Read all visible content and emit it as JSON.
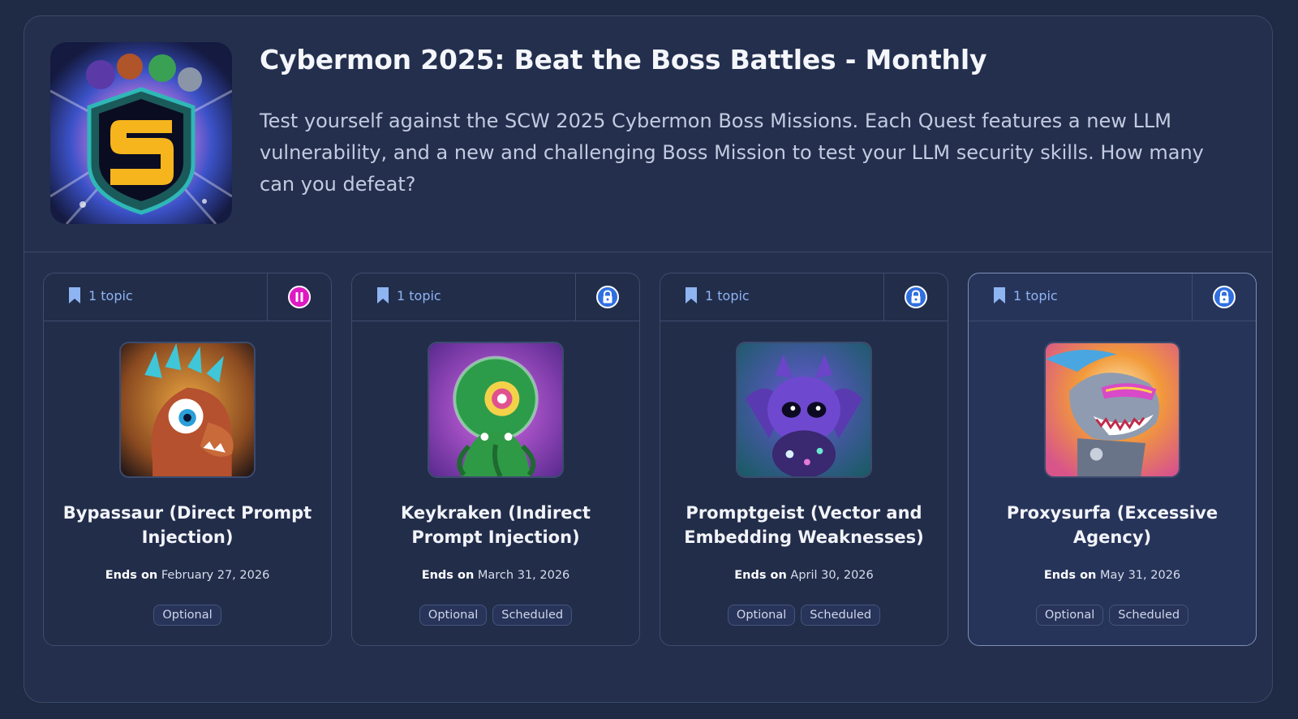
{
  "quest": {
    "title": "Cybermon 2025: Beat the Boss Battles - Monthly",
    "description": "Test yourself against the SCW 2025 Cybermon Boss Missions. Each Quest features a new LLM vulnerability, and a new and challenging Boss Mission to test your LLM security skills. How many can you defeat?",
    "cover_icon": "shield-s-emblem"
  },
  "colors": {
    "background": "#1f2a44",
    "panel": "#232f4d",
    "accent_blue": "#8fb4f2",
    "lock_blue": "#2f6fe0",
    "pause_magenta": "#e01ac3"
  },
  "missions": [
    {
      "topic": "1 topic",
      "status_icon": "pause-icon",
      "title": "Bypassaur (Direct Prompt Injection)",
      "ends_label": "Ends on",
      "ends_date": "February 27, 2026",
      "tags": [
        "Optional"
      ]
    },
    {
      "topic": "1 topic",
      "status_icon": "lock-icon",
      "title": "Keykraken (Indirect Prompt Injection)",
      "ends_label": "Ends on",
      "ends_date": "March 31, 2026",
      "tags": [
        "Optional",
        "Scheduled"
      ]
    },
    {
      "topic": "1 topic",
      "status_icon": "lock-icon",
      "title": "Promptgeist (Vector and Embedding Weaknesses)",
      "ends_label": "Ends on",
      "ends_date": "April 30, 2026",
      "tags": [
        "Optional",
        "Scheduled"
      ]
    },
    {
      "topic": "1 topic",
      "status_icon": "lock-icon",
      "title": "Proxysurfa (Excessive Agency)",
      "ends_label": "Ends on",
      "ends_date": "May 31, 2026",
      "tags": [
        "Optional",
        "Scheduled"
      ]
    }
  ]
}
